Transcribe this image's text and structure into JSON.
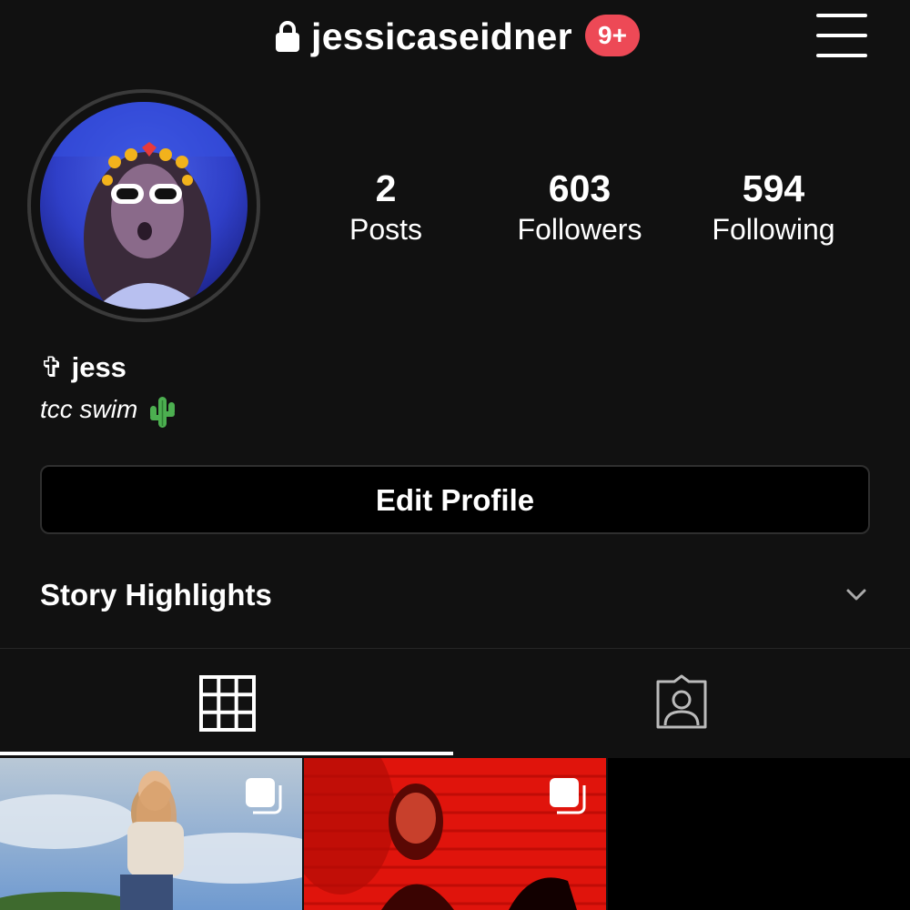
{
  "header": {
    "username": "jessicaseidner",
    "notification_badge": "9+",
    "icons": [
      "lock-icon",
      "menu-icon"
    ]
  },
  "profile": {
    "stats": [
      {
        "value": "2",
        "label": "Posts"
      },
      {
        "value": "603",
        "label": "Followers"
      },
      {
        "value": "594",
        "label": "Following"
      }
    ],
    "display_name": "✞ jess",
    "bio": "tcc swim",
    "bio_emoji": "cactus"
  },
  "actions": {
    "edit_profile_label": "Edit Profile"
  },
  "highlights": {
    "title": "Story Highlights"
  },
  "tabs": [
    {
      "icon": "grid-icon",
      "active": true
    },
    {
      "icon": "tagged-icon",
      "active": false
    }
  ],
  "posts": [
    {
      "theme": "sky",
      "multi_photo": true
    },
    {
      "theme": "red",
      "multi_photo": true
    }
  ],
  "colors": {
    "background": "#111111",
    "badge": "#ed4956",
    "text": "#ffffff",
    "border": "#2f2f2f"
  }
}
